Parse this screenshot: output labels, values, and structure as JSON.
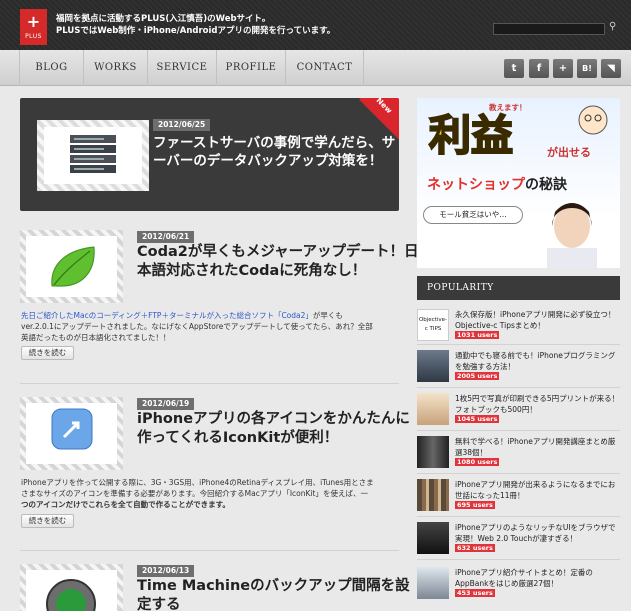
{
  "site": {
    "logo_mark": "+",
    "logo_word": "PLUS",
    "tagline": [
      "福岡を拠点に活動するPLUS(入江慎吾)のWebサイト。",
      "PLUSではWeb制作・iPhone/Androidアプリの開発を行っています。"
    ]
  },
  "nav": {
    "items": [
      {
        "label": "Blog"
      },
      {
        "label": "Works"
      },
      {
        "label": "Service"
      },
      {
        "label": "Profile"
      },
      {
        "label": "Contact"
      }
    ],
    "social": [
      {
        "icon": "tumblr-icon",
        "glyph": "t"
      },
      {
        "icon": "facebook-icon",
        "glyph": "f"
      },
      {
        "icon": "google-plus-icon",
        "glyph": "+"
      },
      {
        "icon": "hatena-icon",
        "glyph": "B!"
      },
      {
        "icon": "rss-icon",
        "glyph": "◥"
      }
    ]
  },
  "featured": {
    "badge": "New",
    "date": "2012/06/25",
    "title": [
      "ファーストサーバの事例で学んだら、サ",
      "ーバーのデータバックアップ対策を！"
    ]
  },
  "posts": [
    {
      "date": "2012/06/21",
      "title": [
        "Coda2が早くもメジャーアップデート！日",
        "本語対応されたCodaに死角なし！"
      ],
      "body_link": "先日ご紹介したMacのコーディング＋FTP＋ターミナルが入った総合ソフト「Coda2」",
      "body": [
        "が早くも",
        "ver.2.0.1にアップデートされました。なにげなくAppStoreでアップデートして使ってたら、あれ？全部",
        "英語だったものが日本語化されてました！！"
      ],
      "read_more": "続きを読む"
    },
    {
      "date": "2012/06/19",
      "title": [
        "iPhoneアプリの各アイコンをかんたんに",
        "作ってくれるIconKitが便利！"
      ],
      "body": [
        "iPhoneアプリを作って公開する際に、3G・3GS用、iPhone4のRetinaディスプレイ用、iTunes用とさま",
        "さまなサイズのアイコンを準備する必要があります。今回紹介するMacアプリ「IconKit」を使えば、一",
        "つのアイコンだけでこれらを全て自動で作ることができます。"
      ],
      "read_more": "続きを読む"
    },
    {
      "date": "2012/06/13",
      "title": [
        "Time Machineのバックアップ間隔を設",
        "定する"
      ]
    }
  ],
  "ad": {
    "kicker": "教えます！",
    "big": "利益",
    "small": "が出せる",
    "sub_pre": "ネットショップ",
    "sub_post": "の秘訣",
    "bubble": "モール貧乏はいや…"
  },
  "popularity": {
    "heading": "Popularity",
    "items": [
      {
        "title": "永久保存版！iPhoneアプリ開発に必ず役立つ！Objective-c Tipsまとめ！",
        "users": "1031 users",
        "thumb_text": "Objective-c TIPS"
      },
      {
        "title": "通勤中でも寝る前でも！iPhoneプログラミングを勉強する方法！",
        "users": "2005 users",
        "thumb_text": ""
      },
      {
        "title": "1枚5円で写真が印刷できる5円プリントが来る！フォトブックも500円！",
        "users": "1045 users",
        "thumb_text": ""
      },
      {
        "title": "無料で学べる！iPhoneアプリ開発講座まとめ厳選38個！",
        "users": "1080 users",
        "thumb_text": ""
      },
      {
        "title": "iPhoneアプリ開発が出来るようになるまでにお世話になった11冊！",
        "users": "695 users",
        "thumb_text": ""
      },
      {
        "title": "iPhoneアプリのようなリッチなUIをブラウザで実現！Web 2.0 Touchが凄すぎる！",
        "users": "632 users",
        "thumb_text": ""
      },
      {
        "title": "iPhoneアプリ紹介サイトまとめ！定番のAppBankをはじめ厳選27個！",
        "users": "453 users",
        "thumb_text": ""
      }
    ]
  }
}
